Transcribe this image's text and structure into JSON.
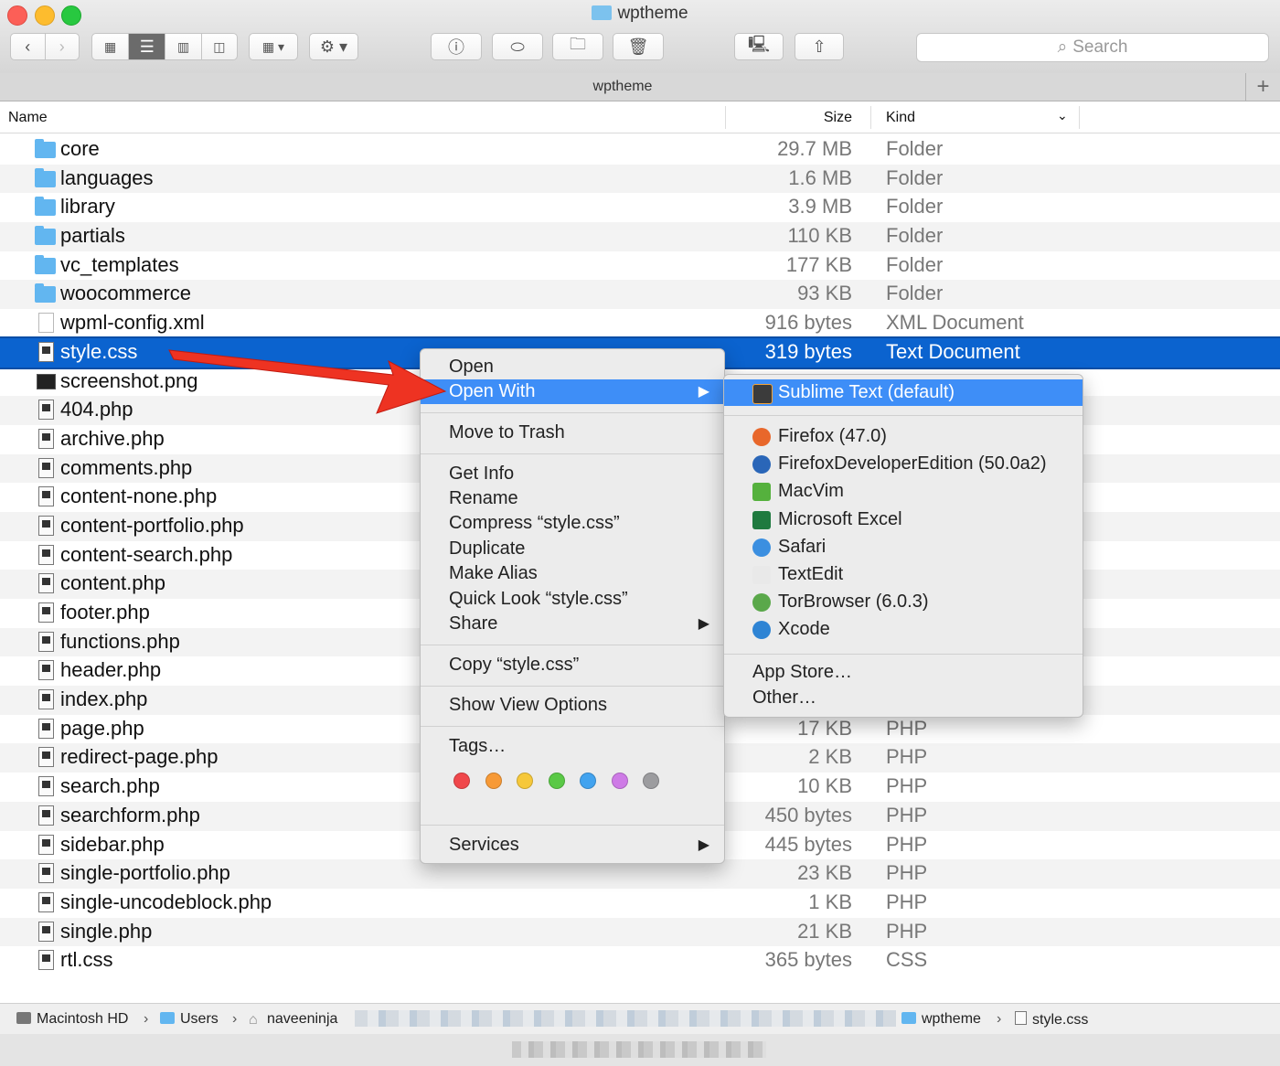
{
  "window": {
    "title": "wptheme"
  },
  "tabbar": {
    "title": "wptheme",
    "add": "+"
  },
  "search": {
    "placeholder": "Search"
  },
  "columns": {
    "name": "Name",
    "size": "Size",
    "kind": "Kind"
  },
  "files": [
    {
      "name": "core",
      "size": "29.7 MB",
      "kind": "Folder",
      "type": "folder"
    },
    {
      "name": "languages",
      "size": "1.6 MB",
      "kind": "Folder",
      "type": "folder"
    },
    {
      "name": "library",
      "size": "3.9 MB",
      "kind": "Folder",
      "type": "folder"
    },
    {
      "name": "partials",
      "size": "110 KB",
      "kind": "Folder",
      "type": "folder"
    },
    {
      "name": "vc_templates",
      "size": "177 KB",
      "kind": "Folder",
      "type": "folder"
    },
    {
      "name": "woocommerce",
      "size": "93 KB",
      "kind": "Folder",
      "type": "folder"
    },
    {
      "name": "wpml-config.xml",
      "size": "916 bytes",
      "kind": "XML Document",
      "type": "doc"
    },
    {
      "name": "style.css",
      "size": "319 bytes",
      "kind": "Text Document",
      "type": "code",
      "selected": true
    },
    {
      "name": "screenshot.png",
      "size": "",
      "kind": "",
      "type": "img"
    },
    {
      "name": "404.php",
      "size": "",
      "kind": "",
      "type": "code"
    },
    {
      "name": "archive.php",
      "size": "",
      "kind": "",
      "type": "code"
    },
    {
      "name": "comments.php",
      "size": "",
      "kind": "",
      "type": "code"
    },
    {
      "name": "content-none.php",
      "size": "",
      "kind": "",
      "type": "code"
    },
    {
      "name": "content-portfolio.php",
      "size": "",
      "kind": "",
      "type": "code"
    },
    {
      "name": "content-search.php",
      "size": "",
      "kind": "",
      "type": "code"
    },
    {
      "name": "content.php",
      "size": "",
      "kind": "",
      "type": "code"
    },
    {
      "name": "footer.php",
      "size": "",
      "kind": "",
      "type": "code"
    },
    {
      "name": "functions.php",
      "size": "",
      "kind": "",
      "type": "code"
    },
    {
      "name": "header.php",
      "size": "",
      "kind": "",
      "type": "code"
    },
    {
      "name": "index.php",
      "size": "",
      "kind": "",
      "type": "code"
    },
    {
      "name": "page.php",
      "size": "17 KB",
      "kind": "PHP",
      "type": "code"
    },
    {
      "name": "redirect-page.php",
      "size": "2 KB",
      "kind": "PHP",
      "type": "code"
    },
    {
      "name": "search.php",
      "size": "10 KB",
      "kind": "PHP",
      "type": "code"
    },
    {
      "name": "searchform.php",
      "size": "450 bytes",
      "kind": "PHP",
      "type": "code"
    },
    {
      "name": "sidebar.php",
      "size": "445 bytes",
      "kind": "PHP",
      "type": "code"
    },
    {
      "name": "single-portfolio.php",
      "size": "23 KB",
      "kind": "PHP",
      "type": "code"
    },
    {
      "name": "single-uncodeblock.php",
      "size": "1 KB",
      "kind": "PHP",
      "type": "code"
    },
    {
      "name": "single.php",
      "size": "21 KB",
      "kind": "PHP",
      "type": "code"
    },
    {
      "name": "rtl.css",
      "size": "365 bytes",
      "kind": "CSS",
      "type": "code"
    }
  ],
  "context_menu": {
    "open": "Open",
    "open_with": "Open With",
    "move_to_trash": "Move to Trash",
    "get_info": "Get Info",
    "rename": "Rename",
    "compress": "Compress “style.css”",
    "duplicate": "Duplicate",
    "make_alias": "Make Alias",
    "quick_look": "Quick Look “style.css”",
    "share": "Share",
    "copy": "Copy “style.css”",
    "show_view_options": "Show View Options",
    "tags": "Tags…",
    "services": "Services",
    "tag_colors": [
      "#f0474b",
      "#f79a37",
      "#f6c83a",
      "#5ac946",
      "#42a3ef",
      "#ce7be6",
      "#9c9c9f"
    ]
  },
  "open_with_menu": {
    "default_app": "Sublime Text (default)",
    "apps": [
      {
        "label": "Firefox (47.0)",
        "icon": "firefox-icon",
        "color": "#e8672b"
      },
      {
        "label": "FirefoxDeveloperEdition (50.0a2)",
        "icon": "firefox-developer-icon",
        "color": "#2a66b8"
      },
      {
        "label": "MacVim",
        "icon": "macvim-icon",
        "color": "#55b13d"
      },
      {
        "label": "Microsoft Excel",
        "icon": "excel-icon",
        "color": "#1f7a3f"
      },
      {
        "label": "Safari",
        "icon": "safari-icon",
        "color": "#3b8fe0"
      },
      {
        "label": "TextEdit",
        "icon": "textedit-icon",
        "color": "#e9e9e9"
      },
      {
        "label": "TorBrowser (6.0.3)",
        "icon": "torbrowser-icon",
        "color": "#5aa84a"
      },
      {
        "label": "Xcode",
        "icon": "xcode-icon",
        "color": "#2e84d4"
      }
    ],
    "app_store": "App Store…",
    "other": "Other…"
  },
  "pathbar": {
    "items": [
      "Macintosh HD",
      "Users",
      "naveeninja",
      "wptheme",
      "style.css"
    ],
    "separator": "›"
  },
  "colors": {
    "selection": "#0b63cf",
    "menu_highlight": "#3e8ef7",
    "annotation_arrow": "#ee3322"
  }
}
